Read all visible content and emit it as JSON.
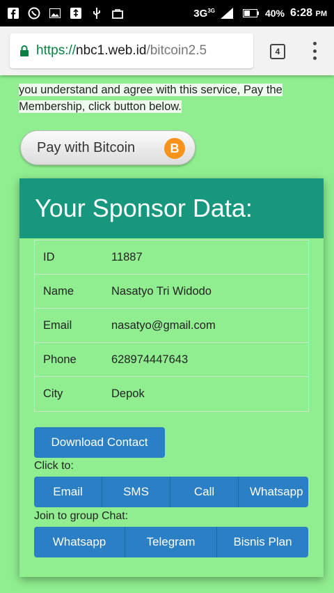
{
  "status_bar": {
    "network": "3G",
    "network_sup": "3G",
    "battery": "40%",
    "time": "6:28",
    "ampm": "PM"
  },
  "browser": {
    "url_scheme": "https://",
    "url_host": "nbc1.web.id",
    "url_path": "/bitcoin2.5",
    "tab_count": "4"
  },
  "intro": {
    "line1": "you understand and agree with this service, Pay the",
    "line2": "Membership, click button below."
  },
  "pay_button": {
    "label": "Pay with Bitcoin",
    "coin": "B"
  },
  "sponsor": {
    "heading": "Your Sponsor Data:",
    "rows": [
      {
        "key": "ID",
        "value": "11887"
      },
      {
        "key": "Name",
        "value": "Nasatyo Tri Widodo"
      },
      {
        "key": "Email",
        "value": "nasatyo@gmail.com"
      },
      {
        "key": "Phone",
        "value": "628974447643"
      },
      {
        "key": "City",
        "value": "Depok"
      }
    ]
  },
  "actions": {
    "download": "Download Contact",
    "click_to": "Click to:",
    "contact_buttons": [
      "Email",
      "SMS",
      "Call",
      "Whatsapp"
    ],
    "join_label": "Join to group Chat:",
    "group_buttons": [
      "Whatsapp",
      "Telegram",
      "Bisnis Plan"
    ]
  },
  "colors": {
    "page_bg": "#90ee90",
    "header_teal": "#17987e",
    "button_blue": "#2b7fc4",
    "bitcoin_orange": "#f7931a"
  }
}
